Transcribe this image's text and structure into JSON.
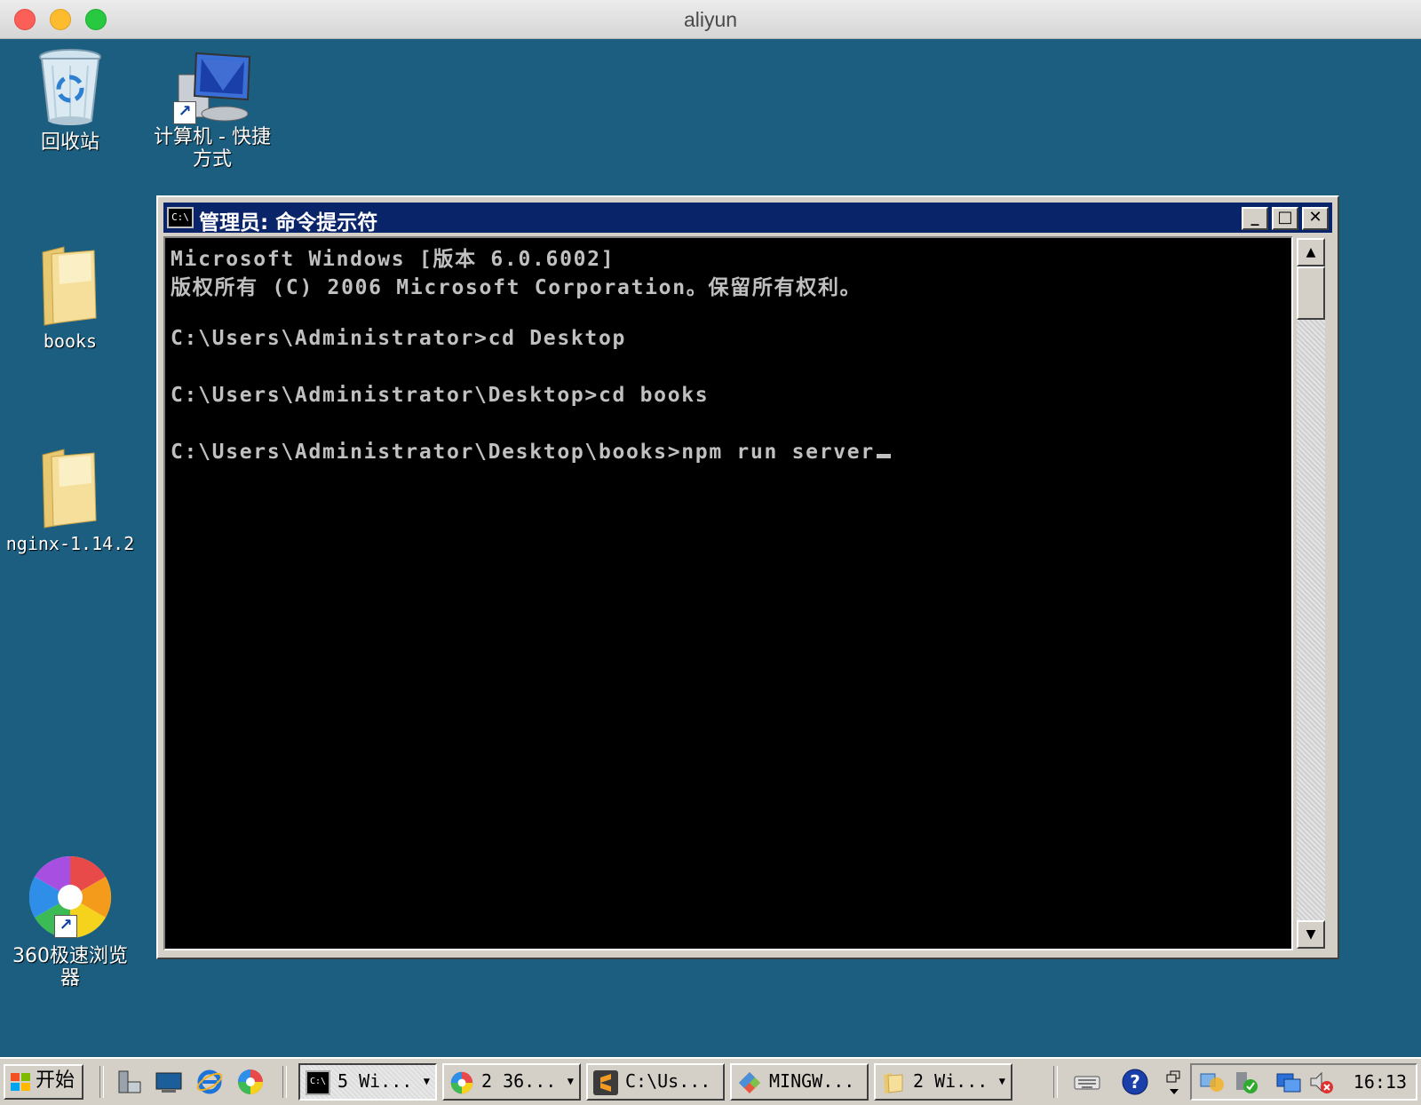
{
  "host_window": {
    "title": "aliyun"
  },
  "desktop": {
    "icons": [
      {
        "label": "回收站"
      },
      {
        "label": "计算机 - 快捷方式"
      },
      {
        "label": "books"
      },
      {
        "label": "nginx-1.14.2"
      },
      {
        "label": "360极速浏览器"
      }
    ]
  },
  "cmd_window": {
    "icon_text": "C:\\",
    "title": "管理员: 命令提示符",
    "controls": {
      "minimize": "_",
      "maximize": "□",
      "close": "✕"
    },
    "lines": [
      "Microsoft Windows [版本 6.0.6002]",
      "版权所有 (C) 2006 Microsoft Corporation。保留所有权利。",
      "",
      "C:\\Users\\Administrator>cd Desktop",
      "",
      "C:\\Users\\Administrator\\Desktop>cd books",
      "",
      "C:\\Users\\Administrator\\Desktop\\books>npm run server"
    ],
    "scroll_up": "▲",
    "scroll_down": "▼"
  },
  "taskbar": {
    "start_label": "开始",
    "tasks": [
      {
        "label": "5 Wi..."
      },
      {
        "label": "2 36..."
      },
      {
        "label": "C:\\Us..."
      },
      {
        "label": "MINGW..."
      },
      {
        "label": "2 Wi..."
      }
    ],
    "dropdown_arrow": "▼",
    "clock": "16:13"
  },
  "colors": {
    "desktop": "#1b5e80",
    "title_bar": "#0a246a",
    "console_bg": "#000000",
    "console_text": "#c0c0c0"
  }
}
